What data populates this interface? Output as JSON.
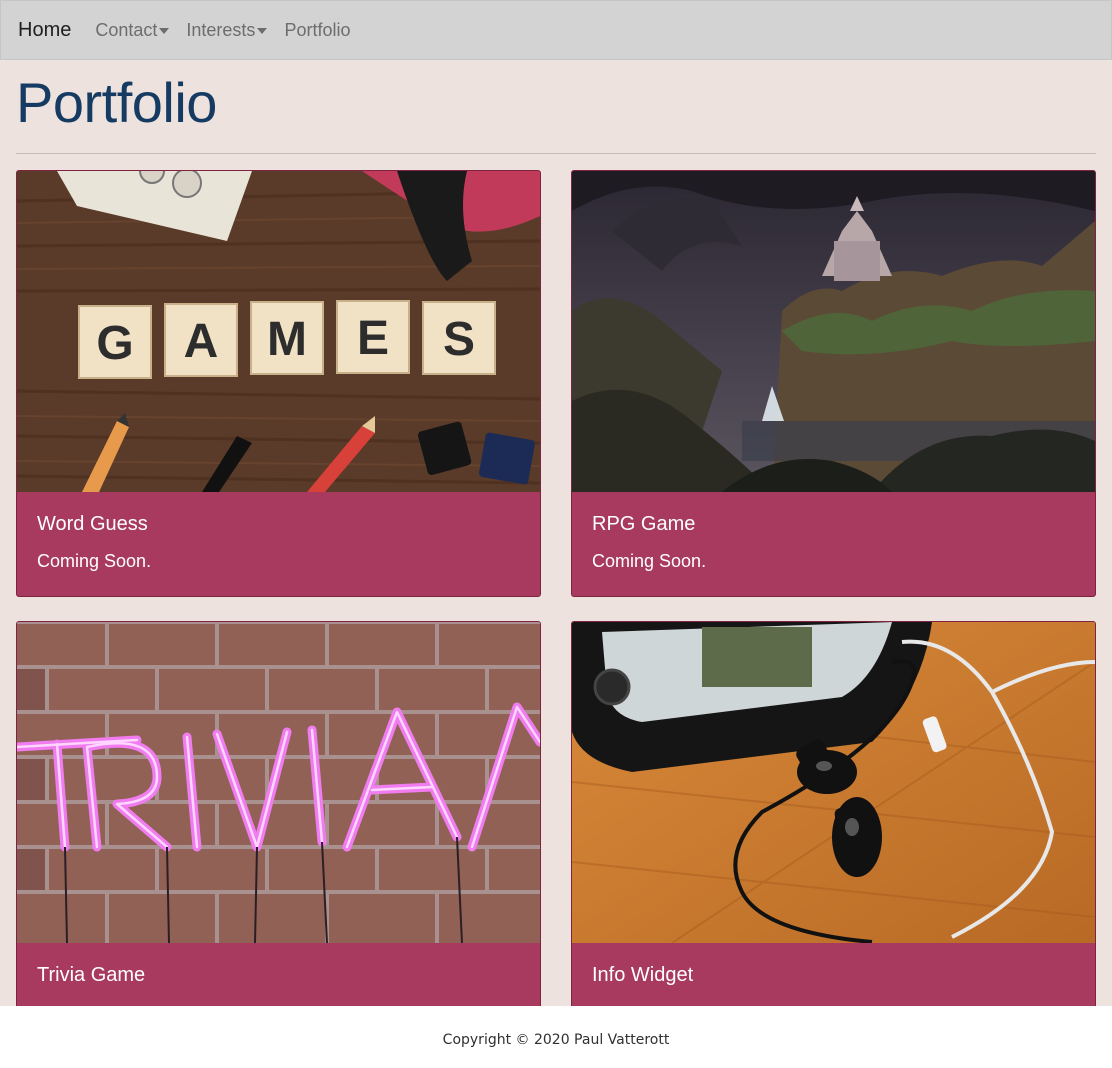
{
  "navbar": {
    "brand": "Home",
    "items": [
      {
        "label": "Contact",
        "dropdown": true
      },
      {
        "label": "Interests",
        "dropdown": true
      },
      {
        "label": "Portfolio",
        "dropdown": false
      }
    ]
  },
  "page": {
    "title": "Portfolio"
  },
  "cards": [
    {
      "title": "Word Guess",
      "text": "Coming Soon.",
      "image": "scrabble-tiles-games-photo"
    },
    {
      "title": "RPG Game",
      "text": "Coming Soon.",
      "image": "fantasy-castle-cliff-painting"
    },
    {
      "title": "Trivia Game",
      "text": "",
      "image": "neon-trivia-sign-photo"
    },
    {
      "title": "Info Widget",
      "text": "",
      "image": "phone-earbuds-photo"
    }
  ],
  "footer": {
    "copyright": "Copyright © 2020 Paul Vatterott"
  },
  "colors": {
    "navbar_bg": "#d3d3d3",
    "page_bg": "#ede2de",
    "title": "#163b63",
    "card_bg": "#a73a5e",
    "card_border": "#7e2442"
  }
}
